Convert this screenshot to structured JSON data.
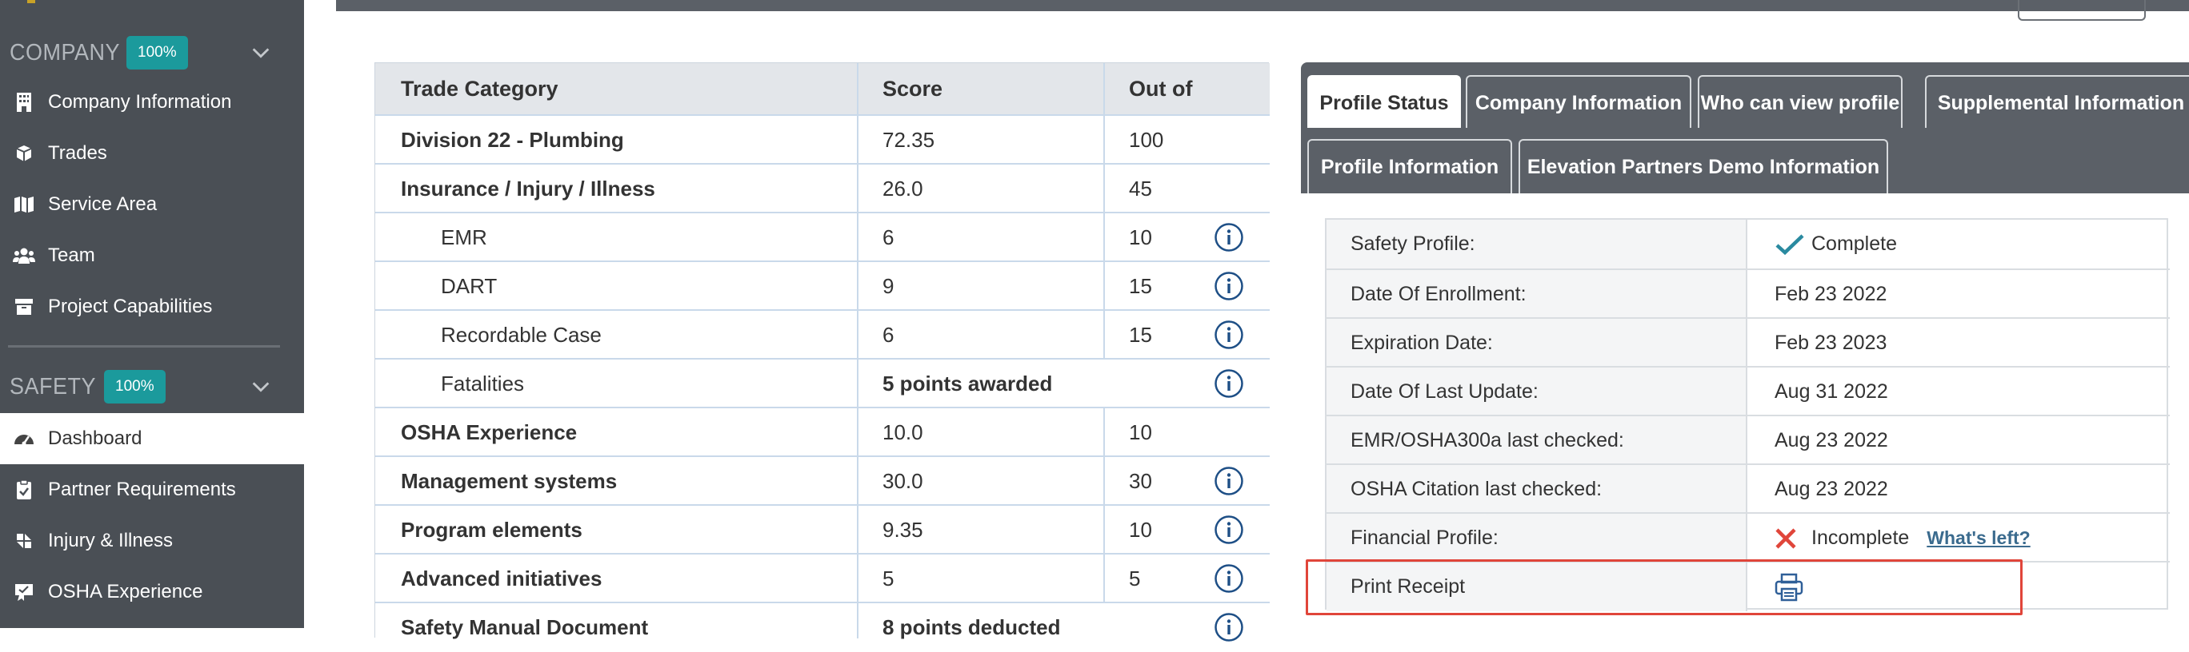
{
  "sidebar": {
    "company": {
      "title": "COMPANY",
      "badge": "100%"
    },
    "company_items": [
      {
        "label": "Company Information",
        "icon": "building-icon"
      },
      {
        "label": "Trades",
        "icon": "cubes-icon"
      },
      {
        "label": "Service Area",
        "icon": "map-icon"
      },
      {
        "label": "Team",
        "icon": "users-icon"
      },
      {
        "label": "Project Capabilities",
        "icon": "archive-icon"
      }
    ],
    "safety": {
      "title": "SAFETY",
      "badge": "100%"
    },
    "safety_items": [
      {
        "label": "Dashboard",
        "icon": "gauge-icon",
        "active": true
      },
      {
        "label": "Partner Requirements",
        "icon": "clipboard-check-icon"
      },
      {
        "label": "Injury & Illness",
        "icon": "medkit-icon"
      },
      {
        "label": "OSHA Experience",
        "icon": "award-icon"
      }
    ]
  },
  "score_table": {
    "headers": {
      "category": "Trade Category",
      "score": "Score",
      "out_of": "Out of"
    },
    "rows": [
      {
        "category": "Division 22 - Plumbing",
        "score": "72.35",
        "out_of": "100",
        "info": false,
        "bold": true
      },
      {
        "category": "Insurance / Injury / Illness",
        "score": "26.0",
        "out_of": "45",
        "info": false,
        "bold": true
      },
      {
        "category": "EMR",
        "score": "6",
        "out_of": "10",
        "info": true,
        "bold": false
      },
      {
        "category": "DART",
        "score": "9",
        "out_of": "15",
        "info": true,
        "bold": false
      },
      {
        "category": "Recordable Case",
        "score": "6",
        "out_of": "15",
        "info": true,
        "bold": false
      },
      {
        "category": "Fatalities",
        "score": "5 points awarded",
        "out_of": "",
        "info": true,
        "bold": false
      },
      {
        "category": "OSHA Experience",
        "score": "10.0",
        "out_of": "10",
        "info": false,
        "bold": true
      },
      {
        "category": "Management systems",
        "score": "30.0",
        "out_of": "30",
        "info": true,
        "bold": true
      },
      {
        "category": "Program elements",
        "score": "9.35",
        "out_of": "10",
        "info": true,
        "bold": true
      },
      {
        "category": "Advanced initiatives",
        "score": "5",
        "out_of": "5",
        "info": true,
        "bold": true
      },
      {
        "category": "Safety Manual Document",
        "score": "8 points deducted",
        "out_of": "",
        "info": true,
        "bold": true
      }
    ]
  },
  "profile_tabs": [
    "Profile Status",
    "Company Information",
    "Who can view profile",
    "Supplemental Information",
    "Profile Information",
    "Elevation Partners Demo Information"
  ],
  "profile_status": {
    "rows": [
      {
        "label": "Safety Profile:",
        "value": "Complete",
        "status": "complete"
      },
      {
        "label": "Date Of Enrollment:",
        "value": "Feb 23 2022"
      },
      {
        "label": "Expiration Date:",
        "value": "Feb 23 2023"
      },
      {
        "label": "Date Of Last Update:",
        "value": "Aug 31 2022"
      },
      {
        "label": "EMR/OSHA300a last checked:",
        "value": "Aug 23 2022"
      },
      {
        "label": "OSHA Citation last checked:",
        "value": "Aug 23 2022"
      },
      {
        "label": "Financial Profile:",
        "value": "Incomplete",
        "status": "incomplete",
        "link": "What's left?"
      },
      {
        "label": "Print Receipt",
        "value": "",
        "icon": "print-icon"
      }
    ]
  },
  "colors": {
    "sidebar_bg": "#4a4f55",
    "badge": "#1b9a9c",
    "check": "#2a8aa0",
    "cross": "#e0453a",
    "highlight": "#e0453a",
    "link": "#3b6b8e"
  }
}
